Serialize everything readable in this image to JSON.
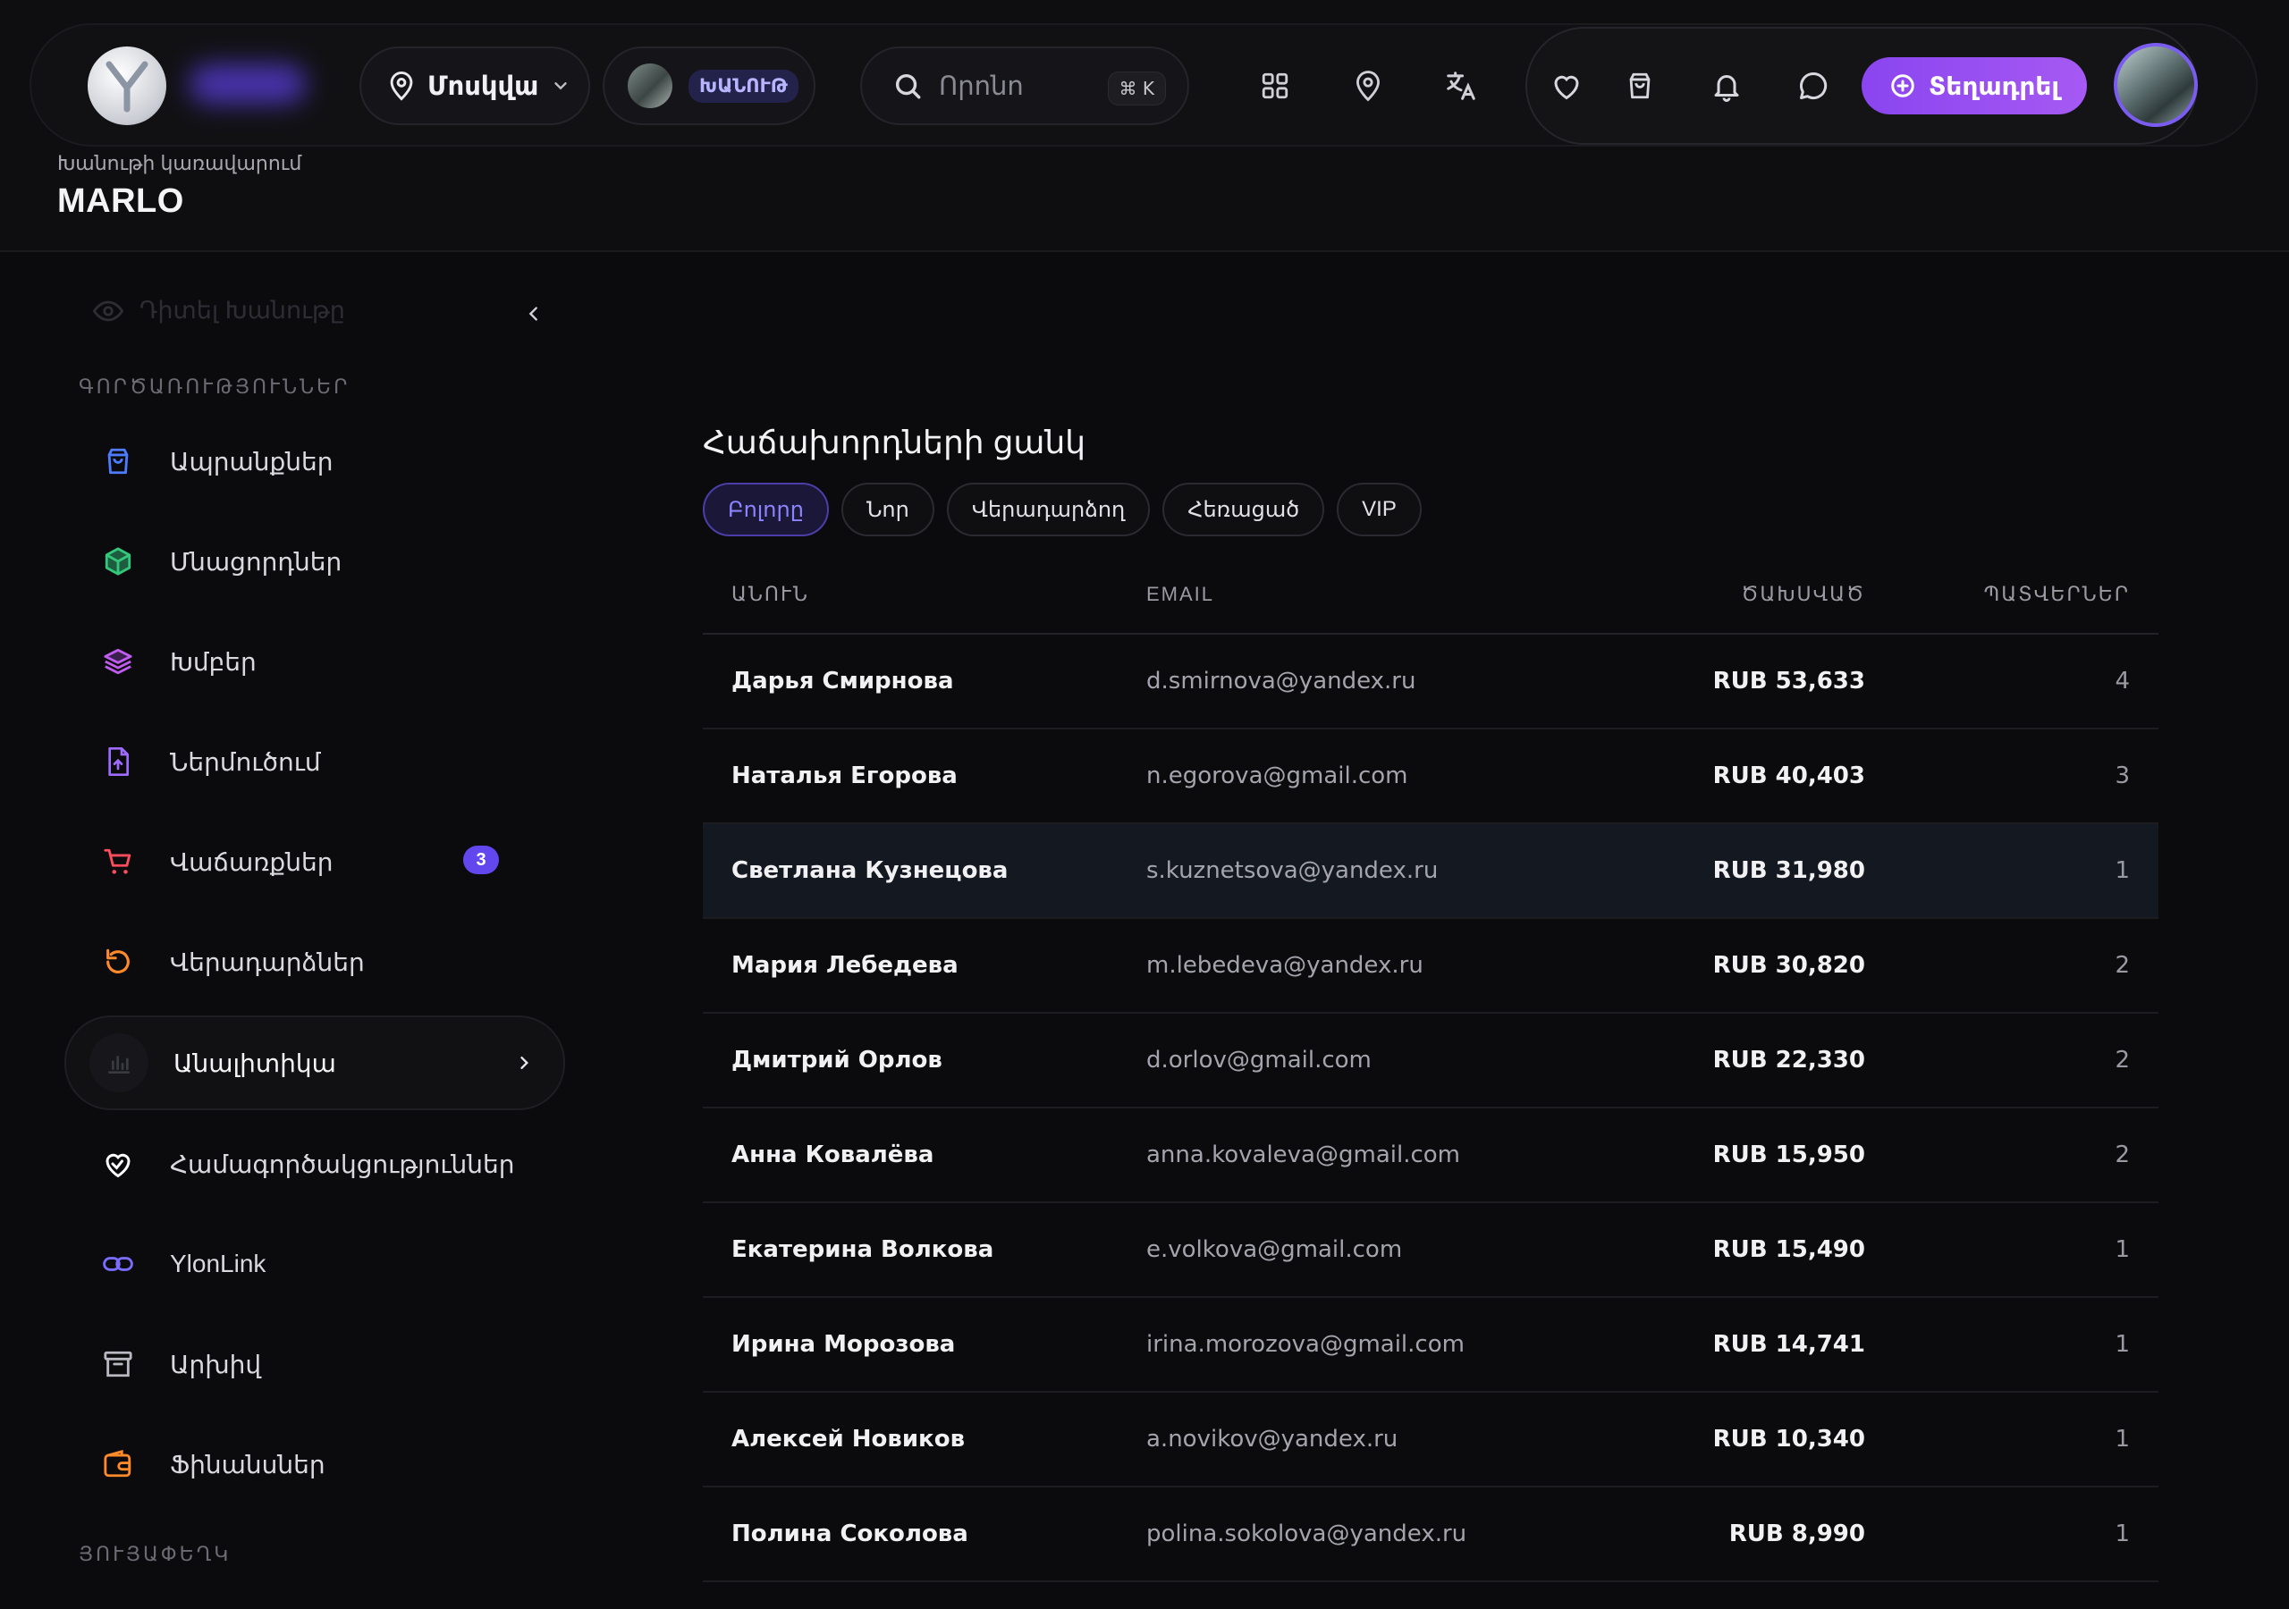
{
  "header": {
    "city": "Մոսկվա",
    "shop_tag": "ԽԱՆՈՒԹ",
    "search_placeholder": "Որոնո",
    "search_shortcut": "⌘ K",
    "publish_label": "Տեղադրել",
    "shop_caption": "Խանութի կառավարում",
    "shop_name": "MARLO"
  },
  "sidebar": {
    "view_shop": "Դիտել Խանութը",
    "section_operations": "ԳՈՐԾԱՌՈՒԹՅՈՒՆՆԵՐ",
    "section_footer": "ՅՈՒՅԱՓԵՂԿ",
    "items": [
      {
        "label": "Ապրանքներ",
        "icon": "bag-icon",
        "color": "#4d7cff"
      },
      {
        "label": "Մնացորդներ",
        "icon": "cube-icon",
        "color": "#34c77b"
      },
      {
        "label": "Խմբեր",
        "icon": "layers-icon",
        "color": "#c05cf0"
      },
      {
        "label": "Ներմուծում",
        "icon": "file-upload-icon",
        "color": "#9d6cff"
      },
      {
        "label": "Վաճառքներ",
        "icon": "cart-icon",
        "color": "#ff4d5e",
        "badge": "3"
      },
      {
        "label": "Վերադարձներ",
        "icon": "undo-icon",
        "color": "#ff8a2a"
      },
      {
        "label": "Անալիտիկա",
        "icon": "bar-chart-icon",
        "color": "#3a3a42"
      },
      {
        "label": "Համագործակցություններ",
        "icon": "heart-handshake-icon",
        "color": "#ffffff"
      },
      {
        "label": "YlonLink",
        "icon": "link-icon",
        "color": "#7a6cff"
      },
      {
        "label": "Արխիվ",
        "icon": "archive-icon",
        "color": "#b9b9c2"
      },
      {
        "label": "Ֆինանսներ",
        "icon": "wallet-icon",
        "color": "#ff8a2a"
      }
    ]
  },
  "main": {
    "title": "Հաճախորդների ցանկ",
    "filters": [
      "Բոլորը",
      "Նոր",
      "Վերադարձող",
      "Հեռացած",
      "VIP"
    ],
    "columns": [
      "ԱՆՈՒՆ",
      "EMAIL",
      "ԾԱԽՍՎԱԾ",
      "ՊԱՏՎԵՐՆԵՐ"
    ],
    "rows": [
      {
        "name": "Дарья Смирнова",
        "email": "d.smirnova@yandex.ru",
        "spent": "RUB 53,633",
        "orders": "4"
      },
      {
        "name": "Наталья Егорова",
        "email": "n.egorova@gmail.com",
        "spent": "RUB 40,403",
        "orders": "3"
      },
      {
        "name": "Светлана Кузнецова",
        "email": "s.kuznetsova@yandex.ru",
        "spent": "RUB 31,980",
        "orders": "1"
      },
      {
        "name": "Мария Лебедева",
        "email": "m.lebedeva@yandex.ru",
        "spent": "RUB 30,820",
        "orders": "2"
      },
      {
        "name": "Дмитрий Орлов",
        "email": "d.orlov@gmail.com",
        "spent": "RUB 22,330",
        "orders": "2"
      },
      {
        "name": "Анна Ковалёва",
        "email": "anna.kovaleva@gmail.com",
        "spent": "RUB 15,950",
        "orders": "2"
      },
      {
        "name": "Екатерина Волкова",
        "email": "e.volkova@gmail.com",
        "spent": "RUB 15,490",
        "orders": "1"
      },
      {
        "name": "Ирина Морозова",
        "email": "irina.morozova@gmail.com",
        "spent": "RUB 14,741",
        "orders": "1"
      },
      {
        "name": "Алексей Новиков",
        "email": "a.novikov@yandex.ru",
        "spent": "RUB 10,340",
        "orders": "1"
      },
      {
        "name": "Полина Соколова",
        "email": "polina.sokolova@yandex.ru",
        "spent": "RUB 8,990",
        "orders": "1"
      }
    ]
  }
}
